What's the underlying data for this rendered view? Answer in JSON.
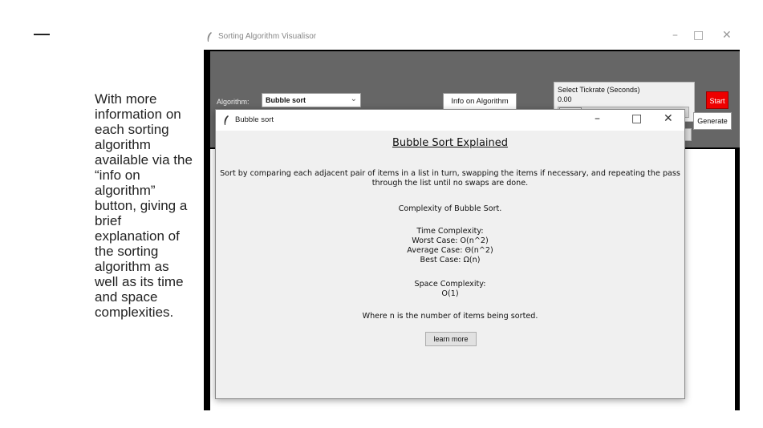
{
  "slide": {
    "caption": "With more information on each sorting algorithm available via the “info on algorithm” button, giving a brief explanation of the sorting algorithm as well as its time and space complexities."
  },
  "main_window": {
    "title": "Sorting Algorithm Visualisor",
    "controls": {
      "minimize": "–",
      "maximize": "□",
      "close": "✕"
    },
    "algorithm_label": "Algorithm:",
    "algorithm_value": "Bubble sort",
    "info_button": "Info on Algorithm",
    "tickrate_label": "Select Tickrate (Seconds)",
    "tickrate_value": "0.00",
    "tickrate_level": 0.0,
    "start_button": "Start",
    "generate_button": "Generate"
  },
  "popup": {
    "title": "Bubble sort",
    "controls": {
      "minimize": "–",
      "maximize": "□",
      "close": "✕"
    },
    "heading": "Bubble Sort Explained",
    "description": "Sort by comparing each adjacent pair of items in a list in turn, swapping the items if necessary, and repeating the pass through the list until no swaps are done.",
    "complexity_heading": "Complexity of Bubble Sort.",
    "time_heading": "Time Complexity:",
    "worst_case": "Worst Case: O(n^2)",
    "average_case": "Average Case: Θ(n^2)",
    "best_case": "Best Case: Ω(n)",
    "space_heading": "Space Complexity:",
    "space_value": "O(1)",
    "note": "Where n is the number of items being sorted.",
    "learn_button": "learn more"
  },
  "colors": {
    "start_button": "#ee0000",
    "control_panel": "#666666",
    "frame": "#000000"
  }
}
